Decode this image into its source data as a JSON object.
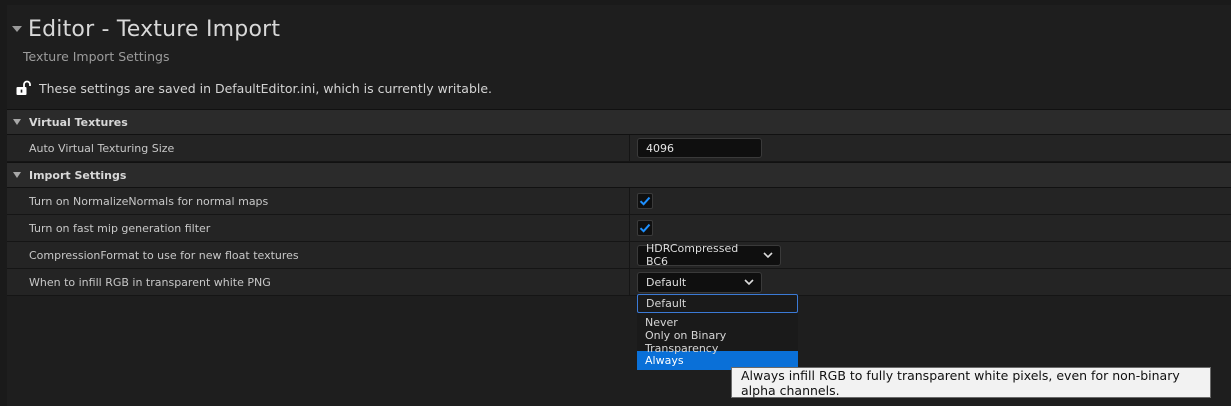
{
  "header": {
    "title": "Editor - Texture Import",
    "subtitle": "Texture Import Settings",
    "notice": "These settings are saved in DefaultEditor.ini, which is currently writable."
  },
  "categories": {
    "virtual_textures": {
      "label": "Virtual Textures",
      "auto_vt_size": {
        "label": "Auto Virtual Texturing Size",
        "value": "4096"
      }
    },
    "import_settings": {
      "label": "Import Settings",
      "normalize_normals": {
        "label": "Turn on NormalizeNormals for normal maps",
        "checked": true
      },
      "fast_mip": {
        "label": "Turn on fast mip generation filter",
        "checked": true
      },
      "compression_format": {
        "label": "CompressionFormat to use for new float textures",
        "value": "HDRCompressed BC6"
      },
      "infill_rgb": {
        "label": "When to infill RGB in transparent white PNG",
        "value": "Default"
      }
    }
  },
  "dropdown": {
    "options": [
      "Default",
      "Never",
      "Only on Binary Transparency",
      "Always"
    ],
    "selected": "Default",
    "highlighted": "Always"
  },
  "tooltip": {
    "text": "Always infill RGB to fully transparent white pixels, even for non-binary alpha channels."
  },
  "colors": {
    "accent": "#0a70d8",
    "check": "#1e90ff"
  },
  "icons": {
    "lock": "unlocked-lock-icon",
    "collapse": "triangle-down-icon",
    "check": "checkmark-icon",
    "chevron": "chevron-down-icon"
  }
}
